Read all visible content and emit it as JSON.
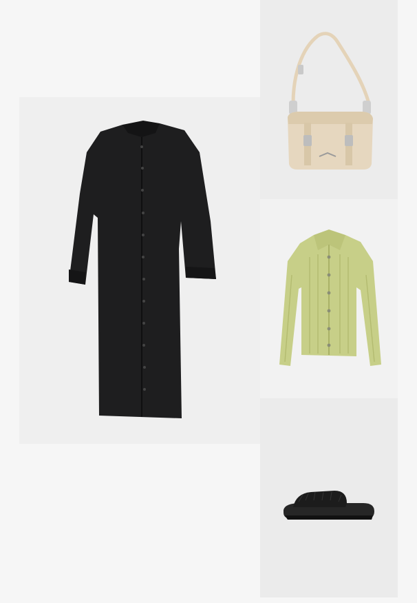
{
  "collage": {
    "background_color": "#f6f6f6",
    "items": [
      {
        "name": "shirt-dress",
        "colorway": "#1e1e1f",
        "tile_color": "#efefef"
      },
      {
        "name": "shoulder-bag",
        "colorway": "#e6d7bf",
        "tile_color": "#ececec"
      },
      {
        "name": "ribbed-cardigan",
        "colorway": "#c7cf88",
        "tile_color": "#f2f2f2"
      },
      {
        "name": "fur-slide-sandal",
        "colorway": "#1c1c1c",
        "tile_color": "#ebebeb"
      }
    ]
  }
}
